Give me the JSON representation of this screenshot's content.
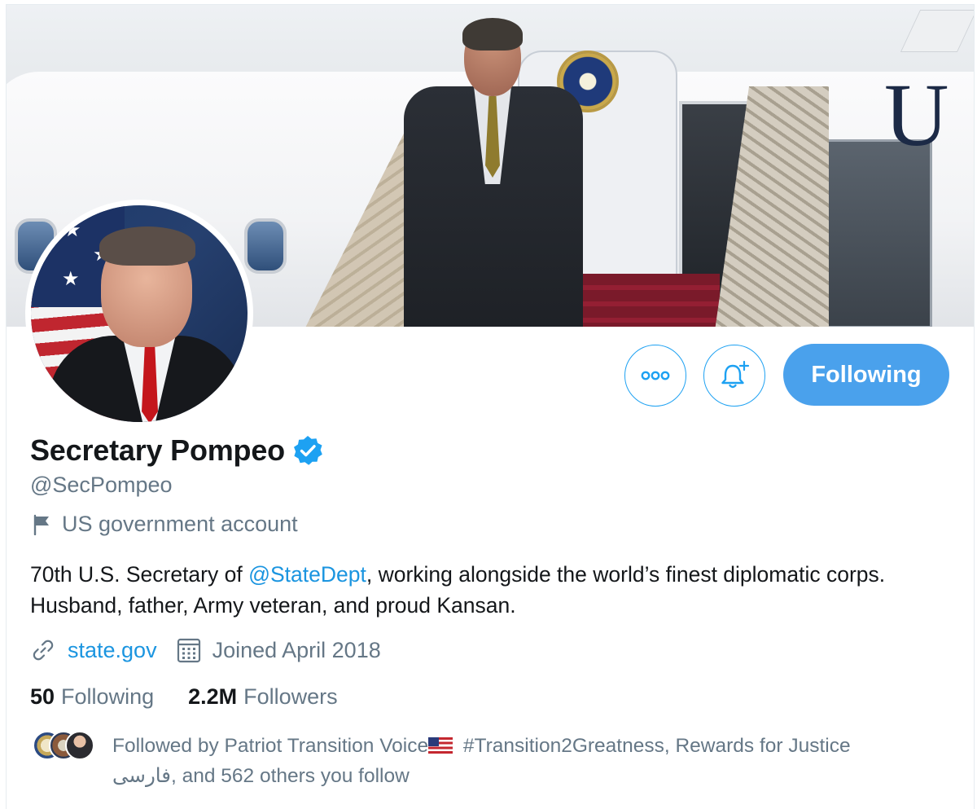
{
  "profile": {
    "display_name": "Secretary Pompeo",
    "handle": "@SecPompeo",
    "label": "US government account",
    "bio_prefix": "70th U.S. Secretary of ",
    "bio_mention": "@StateDept",
    "bio_suffix": ", working alongside the world’s finest diplomatic corps. Husband, father, Army veteran, and proud Kansan.",
    "website": "state.gov",
    "joined": "Joined April 2018",
    "verified": true
  },
  "actions": {
    "following_label": "Following"
  },
  "stats": {
    "following_count": "50",
    "following_label": "Following",
    "followers_count": "2.2M",
    "followers_label": "Followers"
  },
  "followed_by": {
    "prefix": "Followed by ",
    "name1": "Patriot Transition Voice",
    "name2_rest": " #Transition2Greatness, Rewards for Justice",
    "line2": "فارسی, and 562 others you follow"
  },
  "banner": {
    "plane_letter": "U"
  },
  "icons": {
    "more": "more-icon",
    "bell": "bell-plus-icon",
    "verified": "verified-badge-icon",
    "flag": "flag-icon",
    "link": "link-icon",
    "calendar": "calendar-icon"
  },
  "colors": {
    "accent": "#1da1f2",
    "following_button": "#4aa1ec",
    "link": "#1b95e0",
    "secondary_text": "#657786",
    "primary_text": "#14171a"
  }
}
